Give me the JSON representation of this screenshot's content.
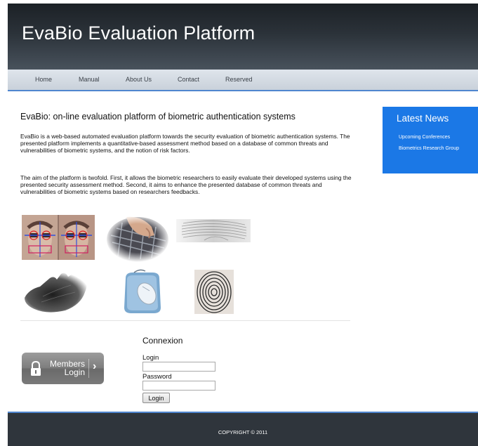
{
  "header": {
    "title": "EvaBio Evaluation Platform"
  },
  "nav": {
    "items": [
      "Home",
      "Manual",
      "About Us",
      "Contact",
      "Reserved"
    ]
  },
  "main": {
    "heading": "EvaBio: on-line evaluation platform of biometric authentication systems",
    "paragraph1": "EvaBio is a web-based automated evaluation platform towards the security evaluation of biometric authentication systems. The presented platform implements a quantitative-based assessment method based on a database of common threats and vulnerabilities of biometric systems, and the notion of risk factors.",
    "paragraph2": "The aim of the platform is twofold. First, it allows the biometric researchers to easily evaluate their developed systems using the presented security assessment method. Second, it aims to enhance the presented database of common threats and vulnerabilities of biometric systems based on researchers feedbacks."
  },
  "news": {
    "title": "Latest News",
    "items": [
      "Upcoming Conferences",
      "Biometrics Research Group"
    ]
  },
  "members": {
    "line1": "Members",
    "line2": "Login"
  },
  "login": {
    "title": "Connexion",
    "login_label": "Login",
    "password_label": "Password",
    "login_value": "",
    "password_value": "",
    "button_label": "Login"
  },
  "footer": {
    "copyright": "COPYRIGHT © 2011"
  },
  "colors": {
    "accent": "#4f86cf",
    "news_bg": "#1b78e6",
    "header_dark": "#1c2126",
    "footer_bg": "#2f353c"
  }
}
